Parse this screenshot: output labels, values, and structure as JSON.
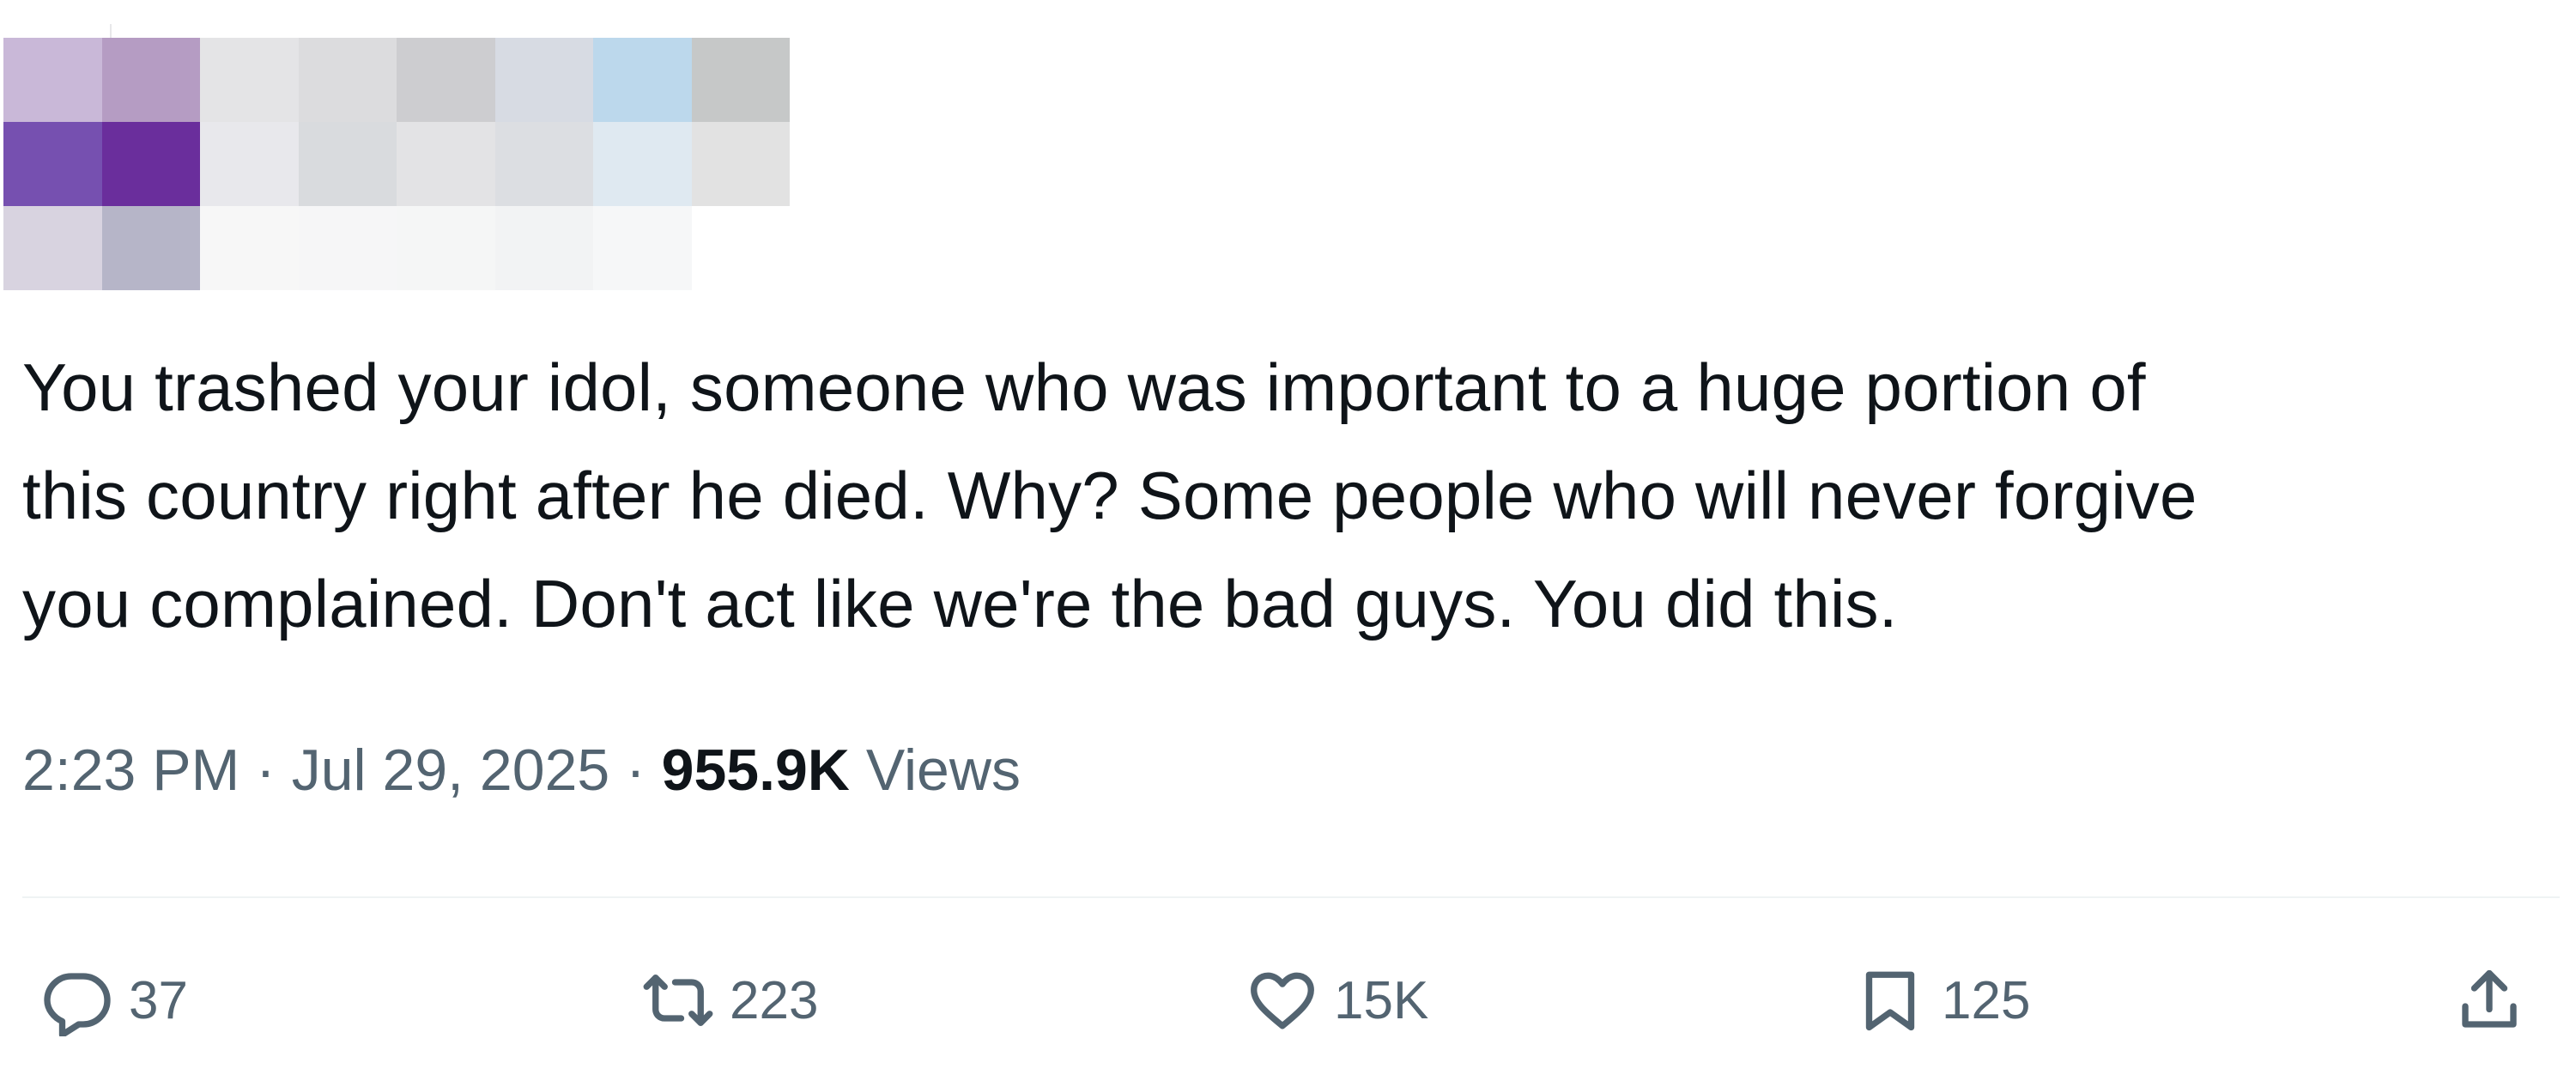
{
  "tweet": {
    "text": "You trashed your idol, someone who was important to a huge portion of\nthis country right after he died. Why? Some people who will never forgive\nyou complained. Don't act like we're the bad guys. You did this.",
    "time": "2:23 PM",
    "separator": " · ",
    "date": "Jul 29, 2025",
    "views_count": "955.9K",
    "views_label": " Views"
  },
  "actions": {
    "reply": {
      "count": "37",
      "icon": "reply-bubble-icon"
    },
    "retweet": {
      "count": "223",
      "icon": "retweet-arrows-icon"
    },
    "like": {
      "count": "15K",
      "icon": "heart-icon"
    },
    "bookmark": {
      "count": "125",
      "icon": "bookmark-icon"
    },
    "share": {
      "icon": "share-upload-icon"
    }
  },
  "colors": {
    "text_primary": "#0f1419",
    "text_secondary": "#536471",
    "divider": "#eff3f4",
    "censor_palette": [
      "#c9b8d8",
      "#b59cc3",
      "#e4e4e6",
      "#dcdcde",
      "#cdcdd0",
      "#d7dbe3",
      "#bcd8ec",
      "#c6c8c8",
      "#7650b0",
      "#6a2e9c",
      "#e8e8ec",
      "#d9dbde",
      "#e3e3e5",
      "#dcdee2",
      "#dfe9f1",
      "#e2e2e2",
      "#d8d3e0",
      "#b6b5c8",
      "#f7f7f7",
      "#f6f6f7",
      "#f5f6f6",
      "#f2f3f4",
      "#f6f7f8",
      "#ffffff"
    ]
  }
}
